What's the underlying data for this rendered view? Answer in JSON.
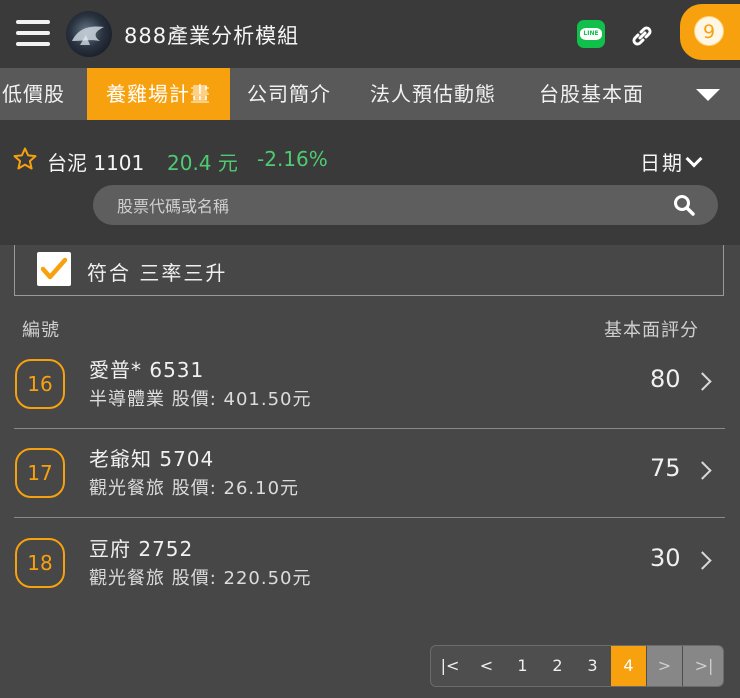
{
  "header": {
    "title": "888產業分析模組",
    "line_label": "LINE",
    "notification_count": "9"
  },
  "tabs": [
    {
      "label": "低價股",
      "active": false
    },
    {
      "label": "養雞場計畫",
      "active": true
    },
    {
      "label": "公司簡介",
      "active": false
    },
    {
      "label": "法人預估動態",
      "active": false
    },
    {
      "label": "台股基本面",
      "active": false
    }
  ],
  "stock": {
    "name": "台泥 1101",
    "price": "20.4 元",
    "change": "-2.16%",
    "date_label": "日期"
  },
  "search": {
    "placeholder": "股票代碼或名稱"
  },
  "filter": {
    "label": "符合 三率三升",
    "checked": true
  },
  "list": {
    "col_id": "編號",
    "col_score": "基本面評分",
    "rows": [
      {
        "num": "16",
        "title": "愛普* 6531",
        "sub": "半導體業  股價: 401.50元",
        "score": "80"
      },
      {
        "num": "17",
        "title": "老爺知 5704",
        "sub": "觀光餐旅  股價: 26.10元",
        "score": "75"
      },
      {
        "num": "18",
        "title": "豆府 2752",
        "sub": "觀光餐旅  股價: 220.50元",
        "score": "30"
      }
    ]
  },
  "pager": {
    "first": "|<",
    "prev": "<",
    "pages": [
      "1",
      "2",
      "3",
      "4"
    ],
    "current": "4",
    "next": ">",
    "last": ">|"
  },
  "colors": {
    "accent": "#f7a10f",
    "up_down": "#4ecb71",
    "line_green": "#11c04a"
  }
}
